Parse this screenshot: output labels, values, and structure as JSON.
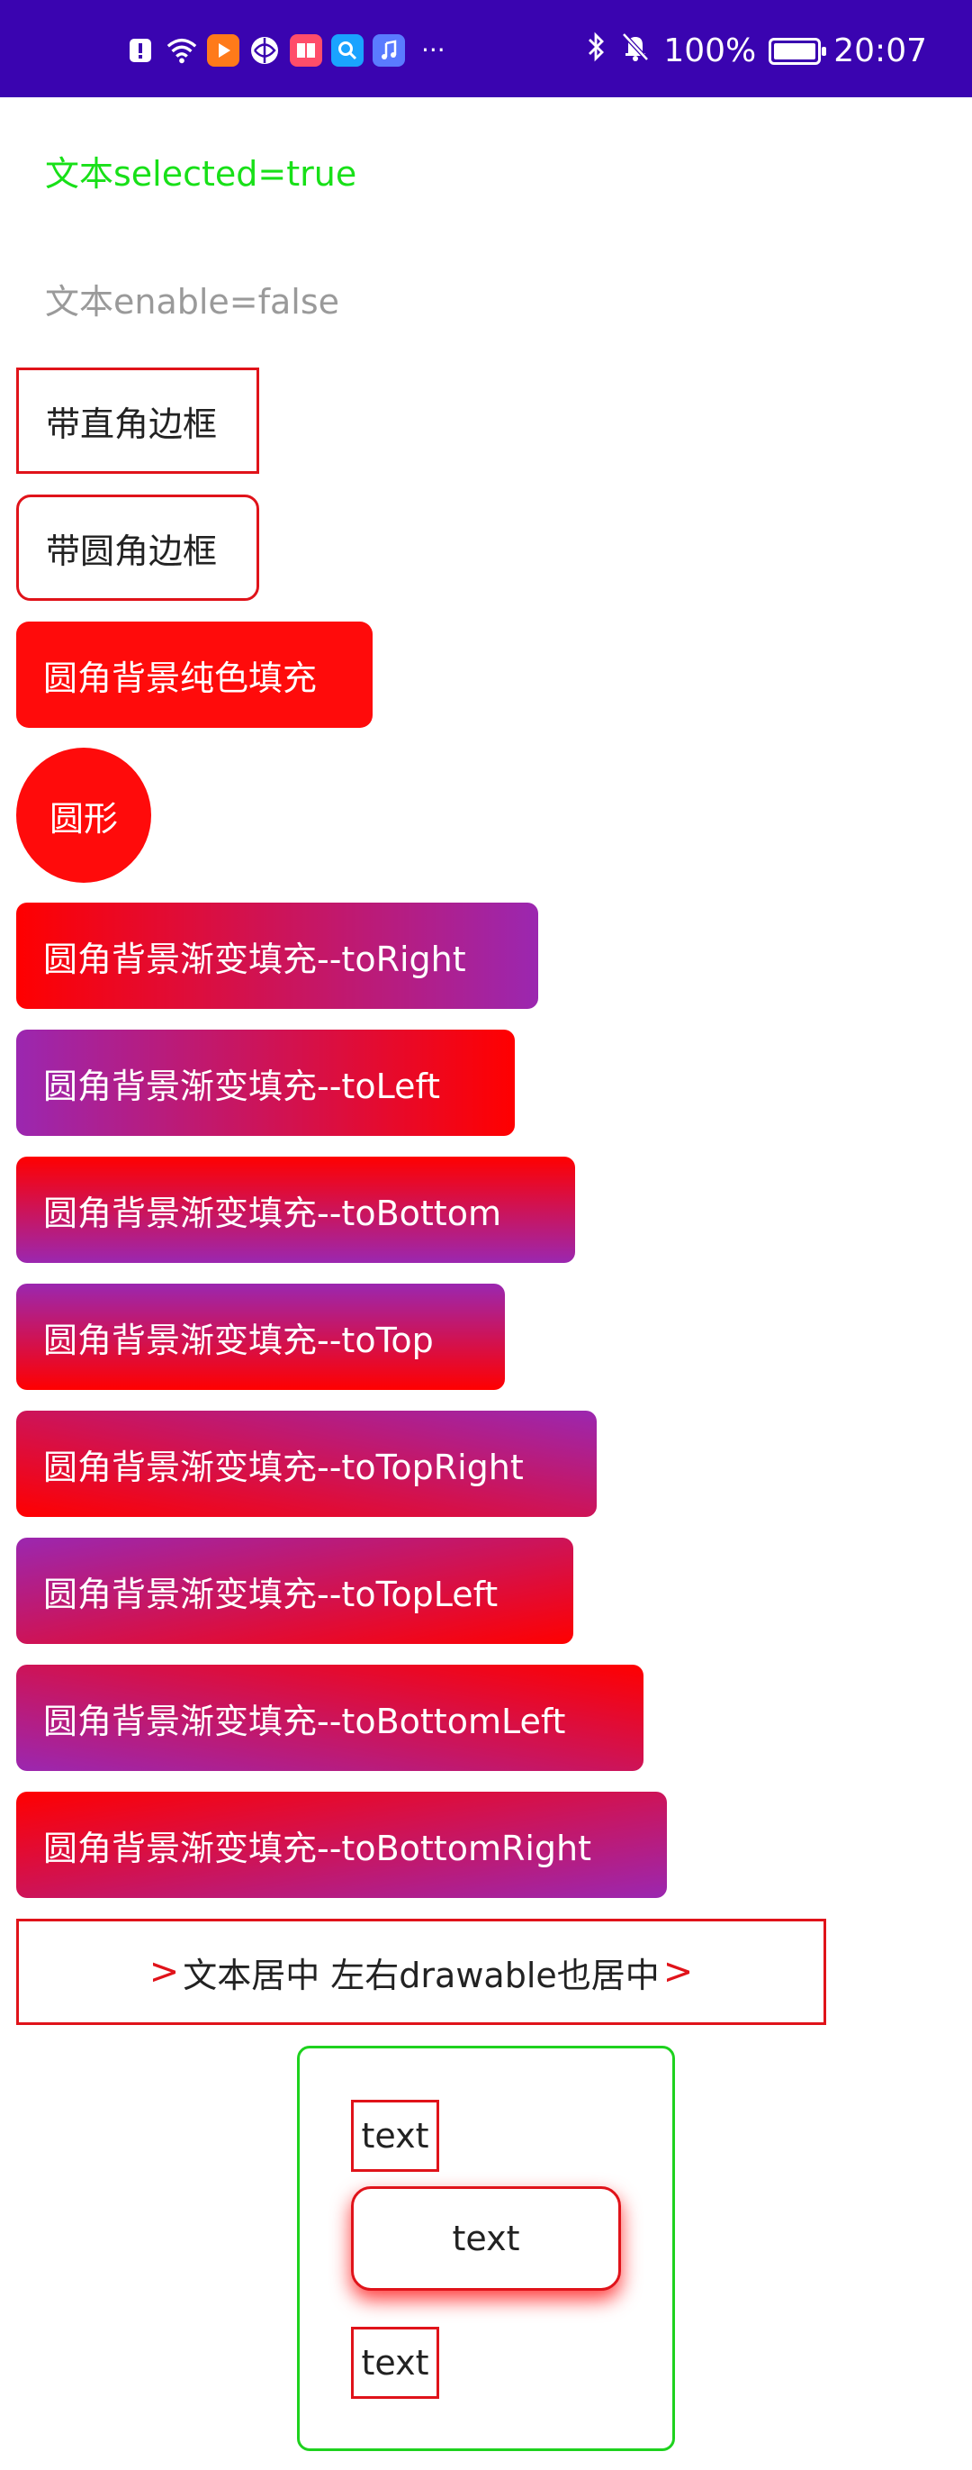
{
  "status_bar": {
    "battery": "100%",
    "time": "20:07",
    "notification_icons": [
      "alert-icon",
      "wifi-icon",
      "video-app-icon",
      "browser-icon",
      "reader-icon",
      "search-app-icon",
      "music-app-icon"
    ],
    "overflow": "···"
  },
  "texts": {
    "selected": "文本selected=true",
    "disabled": "文本enable=false"
  },
  "boxes": {
    "rect_border": "带直角边框",
    "round_border": "带圆角边框",
    "solid_fill": "圆角背景纯色填充",
    "circle": "圆形"
  },
  "gradients": {
    "to_right": "圆角背景渐变填充--toRight",
    "to_left": "圆角背景渐变填充--toLeft",
    "to_bottom": "圆角背景渐变填充--toBottom",
    "to_top": "圆角背景渐变填充--toTop",
    "to_top_right": "圆角背景渐变填充--toTopRight",
    "to_top_left": "圆角背景渐变填充--toTopLeft",
    "to_bottom_left": "圆角背景渐变填充--toBottomLeft",
    "to_bottom_right": "圆角背景渐变填充--toBottomRight"
  },
  "centered": {
    "left_glyph": ">",
    "label": "文本居中 左右drawable也居中",
    "right_glyph": ">"
  },
  "frame": {
    "top_text": "text",
    "middle_text": "text",
    "bottom_text": "text"
  },
  "colors": {
    "status_bar": "#3a04b0",
    "accent_red": "#ff0b0b",
    "gradient_start": "#ff0000",
    "gradient_end": "#9b27b0",
    "selected_green": "#18e018",
    "frame_green": "#1ed21e",
    "disabled_gray": "#9a9a9a"
  }
}
